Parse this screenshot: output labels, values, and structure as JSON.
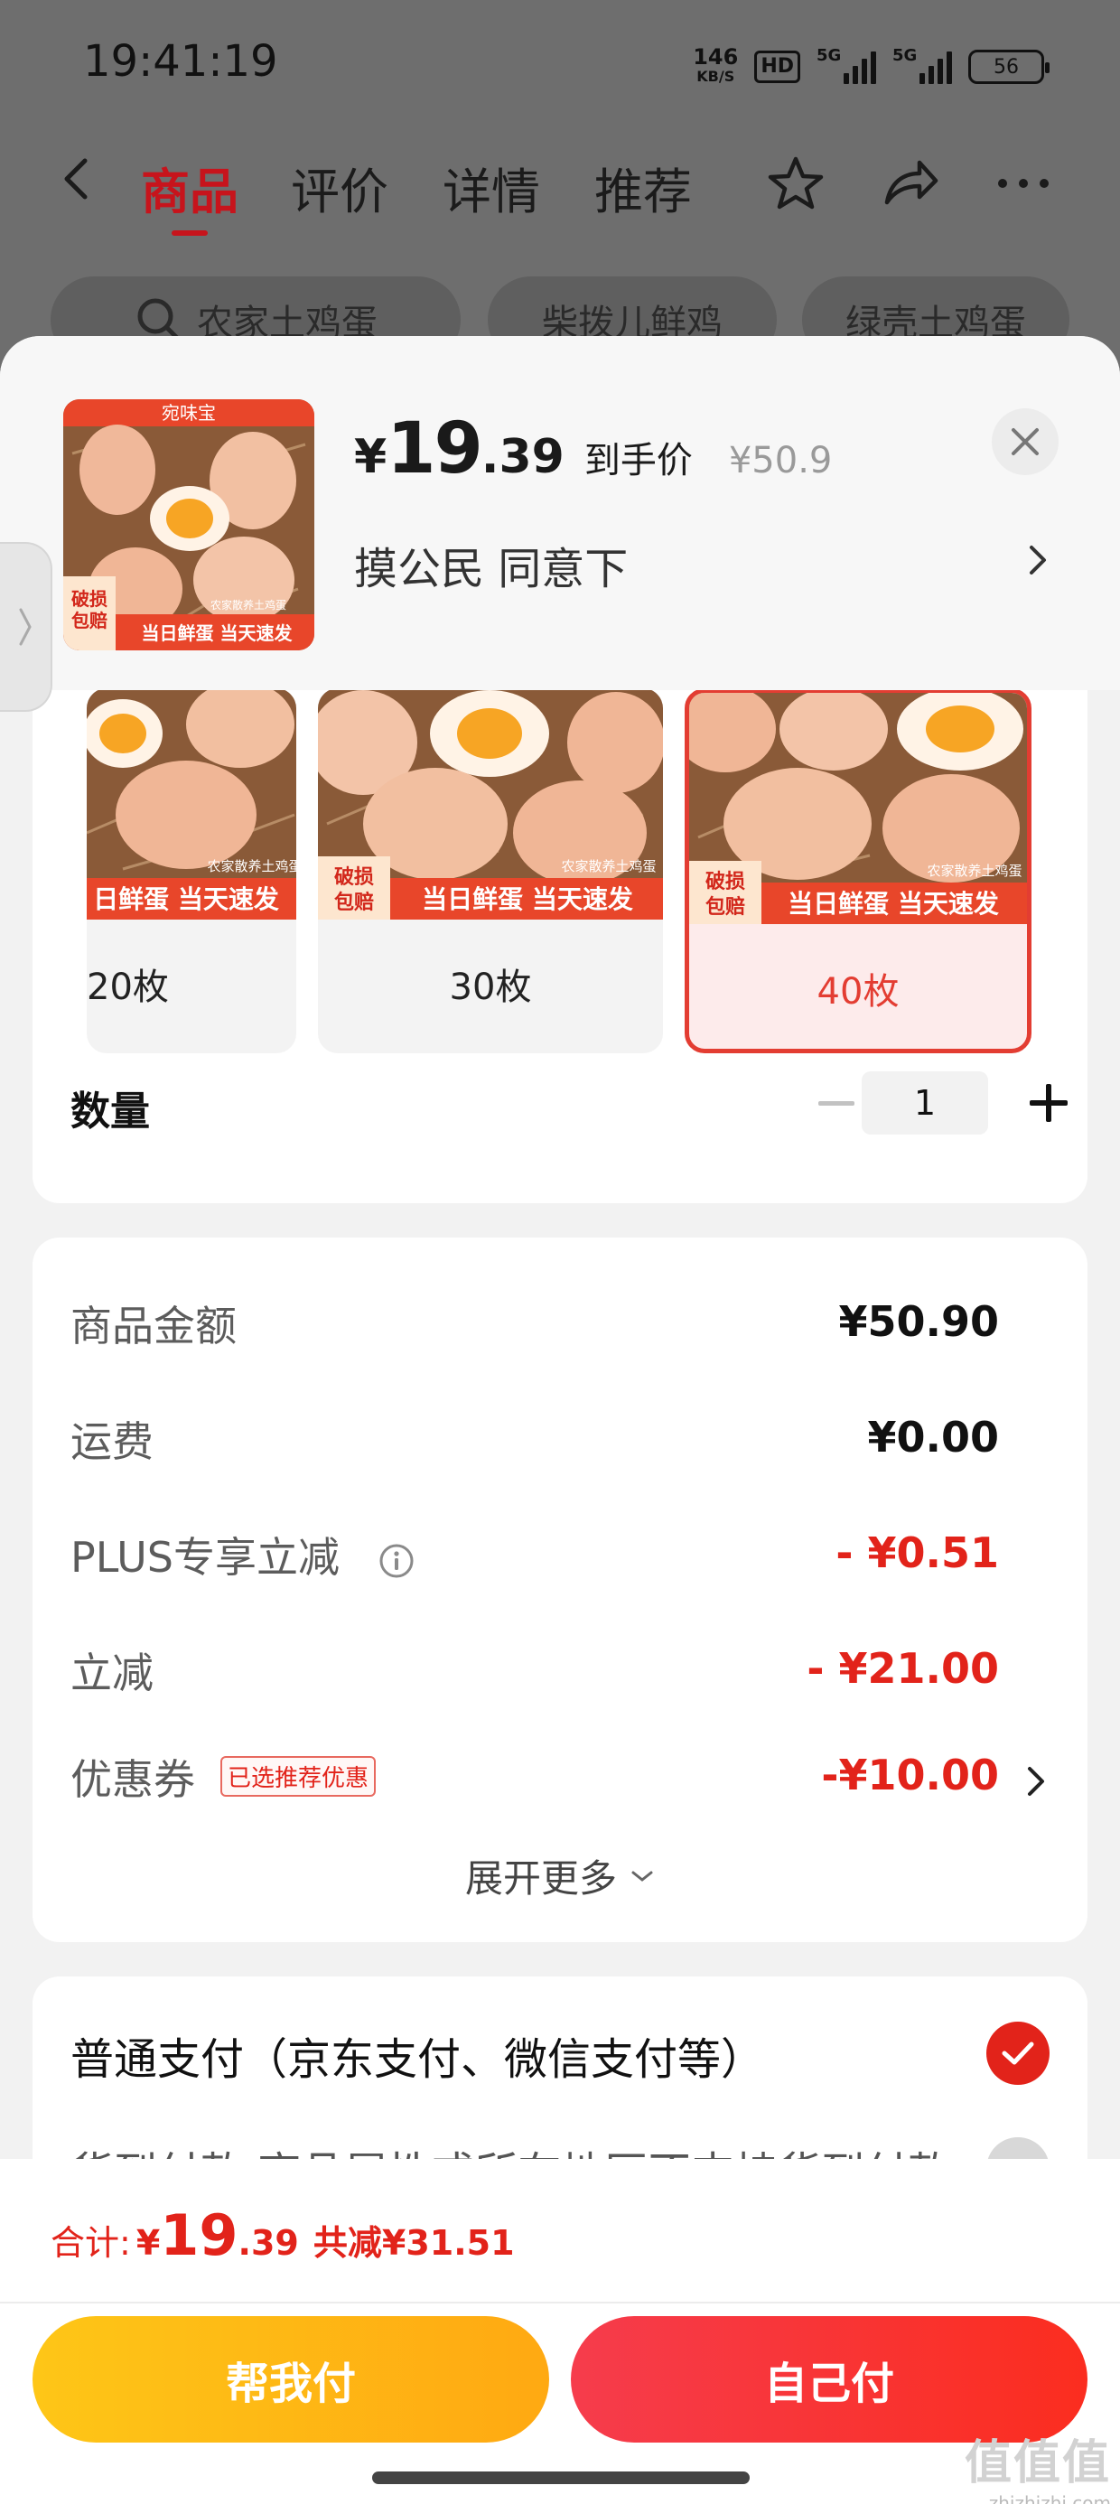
{
  "status_bar": {
    "time": "19:41:19",
    "net_speed_value": "146",
    "net_speed_unit": "KB/S",
    "hd_label": "HD",
    "signal1_label": "5G",
    "signal2_label": "5G",
    "battery": "56"
  },
  "nav": {
    "tabs": [
      {
        "label": "商品",
        "active": true
      },
      {
        "label": "评价",
        "active": false
      },
      {
        "label": "详情",
        "active": false
      },
      {
        "label": "推荐",
        "active": false
      }
    ]
  },
  "search_chips": [
    "农家土鸡蛋",
    "柴拨儿鲜鸡",
    "绿壳土鸡蛋"
  ],
  "product": {
    "brand_label": "宛味宝",
    "thumb_badge": "破损包赔",
    "thumb_banner": "当日鲜蛋 当天速发",
    "thumb_tag": "农家散养土鸡蛋",
    "price_currency": "¥",
    "price_integer": "19",
    "price_decimal": ".39",
    "price_tag": "到手价",
    "original_price": "¥50.9",
    "address": "摸公民  同意下"
  },
  "variants": [
    {
      "label": "20枚",
      "banner": "日鲜蛋 当天速发",
      "badge": "",
      "tag": "农家散养土鸡蛋",
      "selected": false
    },
    {
      "label": "30枚",
      "banner": "当日鲜蛋 当天速发",
      "badge": "破损包赔",
      "tag": "农家散养土鸡蛋",
      "selected": false
    },
    {
      "label": "40枚",
      "banner": "当日鲜蛋 当天速发",
      "badge": "破损包赔",
      "tag": "农家散养土鸡蛋",
      "selected": true
    }
  ],
  "quantity": {
    "label": "数量",
    "value": "1"
  },
  "fees": {
    "goods_label": "商品金额",
    "goods_value": "¥50.90",
    "shipping_label": "运费",
    "shipping_value": "¥0.00",
    "plus_label": "PLUS专享立减",
    "plus_value": "- ¥0.51",
    "discount_label": "立减",
    "discount_value": "- ¥21.00",
    "coupon_label": "优惠券",
    "coupon_badge": "已选推荐优惠",
    "coupon_value": "-¥10.00",
    "expand_label": "展开更多"
  },
  "payment": {
    "option1": "普通支付（京东支付、微信支付等）",
    "option2": "货到付款  商品属性或所在地区不支持货到付款"
  },
  "bottom": {
    "total_label": "合计:",
    "total_currency": "¥",
    "total_integer": "19",
    "total_decimal": ".39",
    "total_saving": "共减¥31.51",
    "btn_help": "帮我付",
    "btn_self": "自己付"
  },
  "watermark": {
    "line1": "值值值",
    "line2": "zhizhizhi.com"
  },
  "colors": {
    "accent_red": "#e2231a",
    "nav_active": "#c7141c",
    "help_btn": "#fec617",
    "self_btn": "#f63c4c"
  }
}
